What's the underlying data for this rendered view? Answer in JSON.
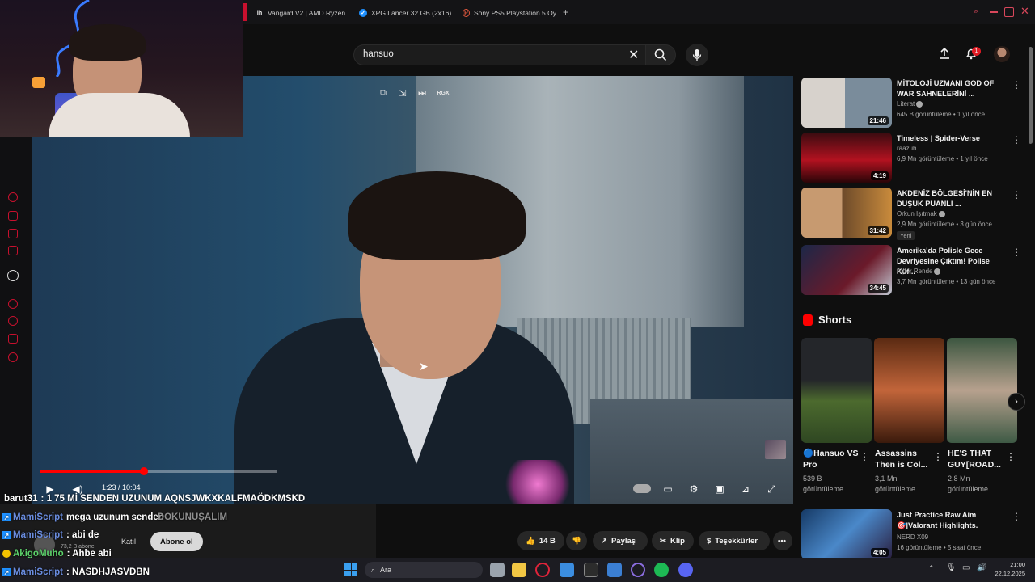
{
  "browser": {
    "tabs": [
      {
        "label": "Vangard V2 | AMD Ryzen",
        "icon": "ih-icon"
      },
      {
        "label": "XPG Lancer 32 GB (2x16)",
        "icon": "check-shield-icon"
      },
      {
        "label": "Sony PS5 Playstation 5 Oy",
        "icon": "p-circle-icon"
      }
    ],
    "new_tab": "+",
    "ai_label": "AI"
  },
  "header": {
    "search_value": "hansuo",
    "notification_count": "1"
  },
  "video": {
    "rgx_label": "RGX",
    "time": "1:23 / 10:04",
    "progress": 0.44
  },
  "chat": [
    {
      "user": "barut31",
      "text": ": 1 75 Mİ SENDEN UZUNUM AQNSJWKXKALFMAÖDKMSKD"
    },
    {
      "user": "MamiScript",
      "text": "mega uzunum senden",
      "overlay": "DOKUNUŞALIM"
    },
    {
      "user": "MamiScript",
      "text": ": abi de"
    },
    {
      "user": "AkigoMuho",
      "text": ": Ahbe abi"
    },
    {
      "user": "MamiScript",
      "text": ": NASDHJASVDBN"
    }
  ],
  "channel": {
    "subscribers": "73,2 B abone",
    "join_label": "Katıl",
    "subscribe_label": "Abone ol"
  },
  "actions": {
    "likes": "14 B",
    "share": "Paylaş",
    "clip": "Klip",
    "thanks": "Teşekkürler"
  },
  "recommendations": [
    {
      "title": "MİTOLOJİ UZMANI GOD OF WAR SAHNELERİNİ ...",
      "channel": "Literat",
      "meta": "645 B görüntüleme • 1 yıl önce",
      "duration": "21:46"
    },
    {
      "title": "Timeless | Spider-Verse",
      "channel": "raazuh",
      "meta": "6,9 Mn görüntüleme • 1 yıl önce",
      "duration": "4:19"
    },
    {
      "title": "AKDENİZ BÖLGESİ'NİN EN DÜŞÜK PUANLI ...",
      "channel": "Orkun Işıtmak",
      "meta": "2,9 Mn görüntüleme • 3 gün önce",
      "duration": "31:42",
      "badge": "Yeni"
    },
    {
      "title": "Amerika'da Polisle Gece Devriyesine Çıktım! Polise Küf...",
      "channel": "Alper Rende",
      "meta": "3,7 Mn görüntüleme • 13 gün önce",
      "duration": "34:45"
    },
    {
      "title": "Just Practice Raw Aim 🎯|Valorant Highlights.",
      "channel": "NERD X09",
      "meta": "16 görüntüleme • 5 saat önce",
      "duration": "4:05"
    }
  ],
  "shorts": {
    "title": "Shorts",
    "items": [
      {
        "title": "🔵Hansuo VS Pro",
        "views": "539 B görüntüleme"
      },
      {
        "title": "Assassins Then is Col...",
        "views": "3,1 Mn görüntüleme"
      },
      {
        "title": "HE'S THAT GUY[ROAD...",
        "views": "2,8 Mn görüntüleme"
      }
    ]
  },
  "taskbar": {
    "search_placeholder": "Ara",
    "time": "21:00",
    "date": "22.12.2025"
  }
}
